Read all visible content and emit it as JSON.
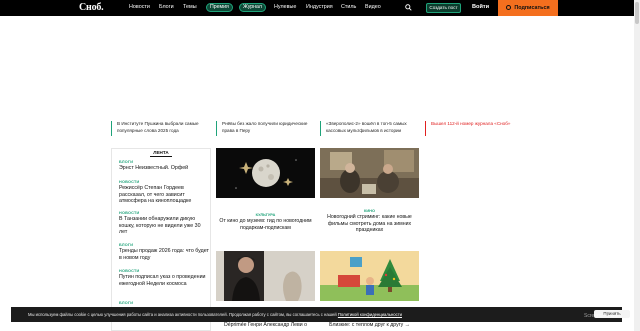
{
  "header": {
    "logo": "Сноб.",
    "nav": [
      "Новости",
      "Блоги",
      "Темы"
    ],
    "pills": [
      "Премия",
      "Журнал"
    ],
    "nav2": [
      "Нулевые",
      "Индустрия",
      "Стиль",
      "Видео"
    ],
    "create_post": "Создать пост",
    "login": "Войти",
    "subscribe": "Подписаться"
  },
  "ticker": [
    {
      "text": "В Институте Пушкина выбрали самые популярные слова 2025 года"
    },
    {
      "text": "Pнёвы без жало получили юридические права в Перу"
    },
    {
      "text": "«Зверополис-2» вошёл в топ-5 самых кассовых мультфильмов в истории"
    },
    {
      "text": "Вышел 112-й номер журнала «Сноб»"
    }
  ],
  "feed": {
    "tab": "ЛЕНТА",
    "items": [
      {
        "cat": "БЛОГИ",
        "title": "Эрнст Неизвестный. Орфей"
      },
      {
        "cat": "НОВОСТИ",
        "title": "Режиссёр Степан Гордеев рассказал, от чего зависит атмосфера на киноплощадке"
      },
      {
        "cat": "НОВОСТИ",
        "title": "В Танзании обнаружили дикую кошку, которую не видели уже 30 лет"
      },
      {
        "cat": "БЛОГИ",
        "title": "Тренды продаж 2026 года: что будет в новом году"
      },
      {
        "cat": "НОВОСТИ",
        "title": "Путин подписал указ о проведении ежегодной Недели космоса"
      },
      {
        "cat": "БЛОГИ",
        "title": ""
      }
    ]
  },
  "cards": [
    {
      "cat": "КУЛЬТУРА",
      "title": "От кино до музеев: гид по новогодним подаркам-подпискам"
    },
    {
      "cat": "КИНО",
      "title": "Новогодний стриминг: какие новые фильмы смотреть дома на зимних праздниках"
    },
    {
      "cat": "",
      "title": "Déprimée Генри Александр Леви о"
    },
    {
      "cat": "",
      "title": "Близкие: с теплом друг к другу →"
    }
  ],
  "cookie": {
    "text": "Мы используем файлы cookie с целью улучшения работы сайта и анализа активности пользователей. Продолжая работу с сайтом, вы соглашаетесь с нашей ",
    "link": "Политикой конфиденциальности",
    "accept": "Принять"
  },
  "watermark": "Screenshot Guru"
}
